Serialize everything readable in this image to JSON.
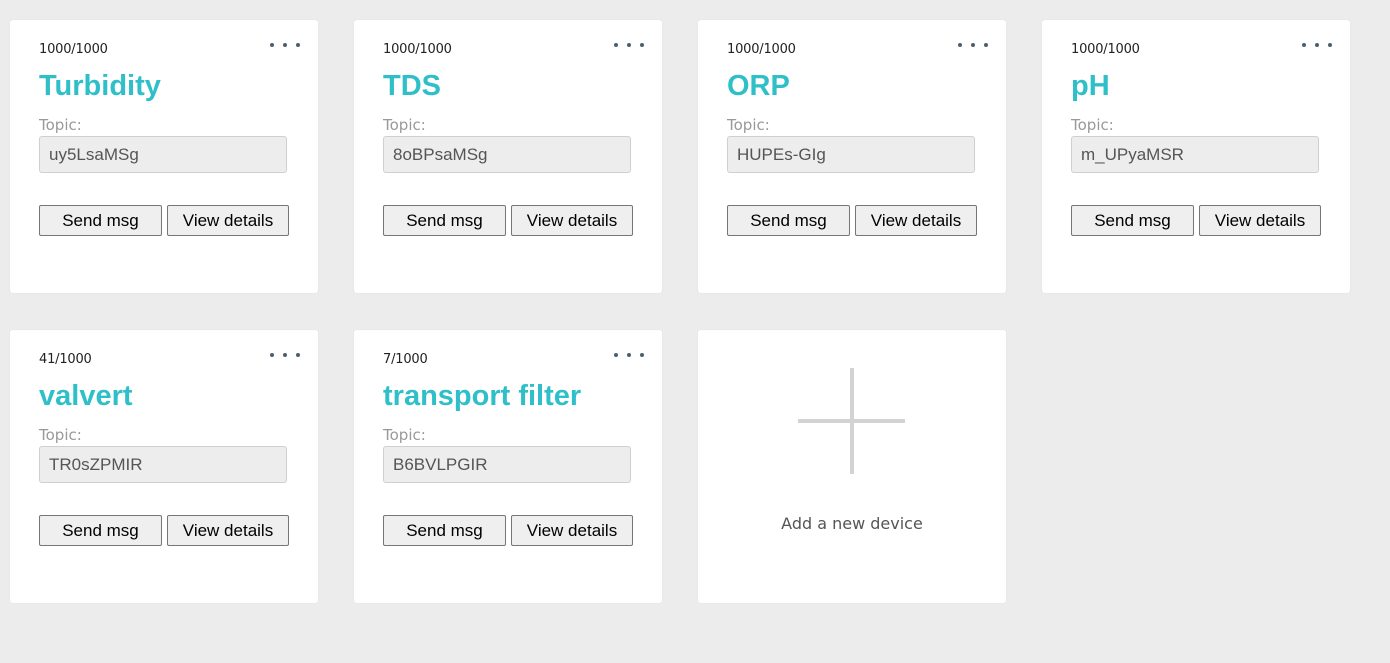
{
  "devices": [
    {
      "quota": "1000/1000",
      "name": "Turbidity",
      "topic_label": "Topic:",
      "topic": "uy5LsaMSg",
      "send_label": "Send msg",
      "view_label": "View details"
    },
    {
      "quota": "1000/1000",
      "name": "TDS",
      "topic_label": "Topic:",
      "topic": "8oBPsaMSg",
      "send_label": "Send msg",
      "view_label": "View details"
    },
    {
      "quota": "1000/1000",
      "name": "ORP",
      "topic_label": "Topic:",
      "topic": "HUPEs-GIg",
      "send_label": "Send msg",
      "view_label": "View details"
    },
    {
      "quota": "1000/1000",
      "name": "pH",
      "topic_label": "Topic:",
      "topic": "m_UPyaMSR",
      "send_label": "Send msg",
      "view_label": "View details"
    },
    {
      "quota": "41/1000",
      "name": "valvert",
      "topic_label": "Topic:",
      "topic": "TR0sZPMIR",
      "send_label": "Send msg",
      "view_label": "View details"
    },
    {
      "quota": "7/1000",
      "name": "transport filter",
      "topic_label": "Topic:",
      "topic": "B6BVLPGIR",
      "send_label": "Send msg",
      "view_label": "View details"
    }
  ],
  "add_device": {
    "label": "Add a new device",
    "icon": "plus-icon"
  },
  "colors": {
    "accent": "#2fbfc9",
    "background": "#ececec",
    "card": "#ffffff",
    "menu_dots": "#4d5f6e"
  }
}
